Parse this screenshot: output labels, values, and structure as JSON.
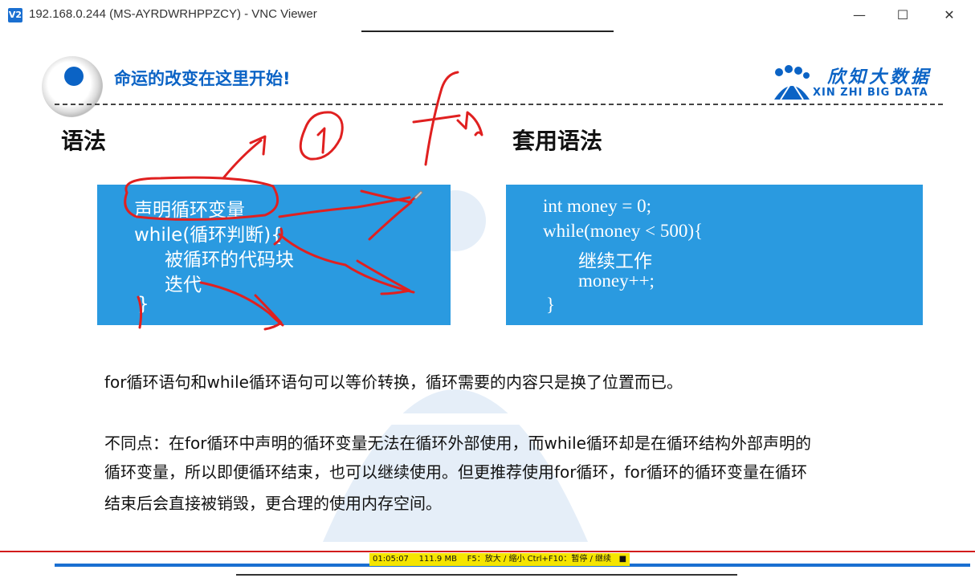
{
  "window": {
    "icon": "V2",
    "title": "192.168.0.244 (MS-AYRDWRHPPZCY) - VNC Viewer",
    "minimize": "—",
    "maximize": "☐",
    "close": "✕"
  },
  "slide": {
    "title": "命运的改变在这里开始!",
    "logo_cn": "欣知大数据",
    "logo_en": "XIN ZHI BIG DATA",
    "left_heading": "语法",
    "right_heading": "套用语法",
    "left_code": [
      "声明循环变量",
      "while(循环判断){",
      "被循环的代码块",
      "迭代",
      "}"
    ],
    "right_code": [
      "int money = 0;",
      "while(money < 500){",
      "继续工作",
      "money++;",
      "}"
    ],
    "para1": "for循环语句和while循环语句可以等价转换，循环需要的内容只是换了位置而已。",
    "para2_line1": "不同点：在for循环中声明的循环变量无法在循环外部使用，而while循环却是在循环结构外部声明的",
    "para2_line2": "循环变量，所以即便循环结束，也可以继续使用。但更推荐使用for循环，for循环的循环变量在循环",
    "para2_line3": "结束后会直接被销毁，更合理的使用内存空间。"
  },
  "statusbar": {
    "time": "01:05:07",
    "size": "111.9 MB",
    "hint": "F5：放大 / 缩小 Ctrl+F10：暂停 / 继续",
    "stop": "■"
  },
  "colors": {
    "accent": "#0b63c5",
    "box": "#2a9ae0",
    "ink": "#e02020",
    "status": "#f5e500"
  }
}
